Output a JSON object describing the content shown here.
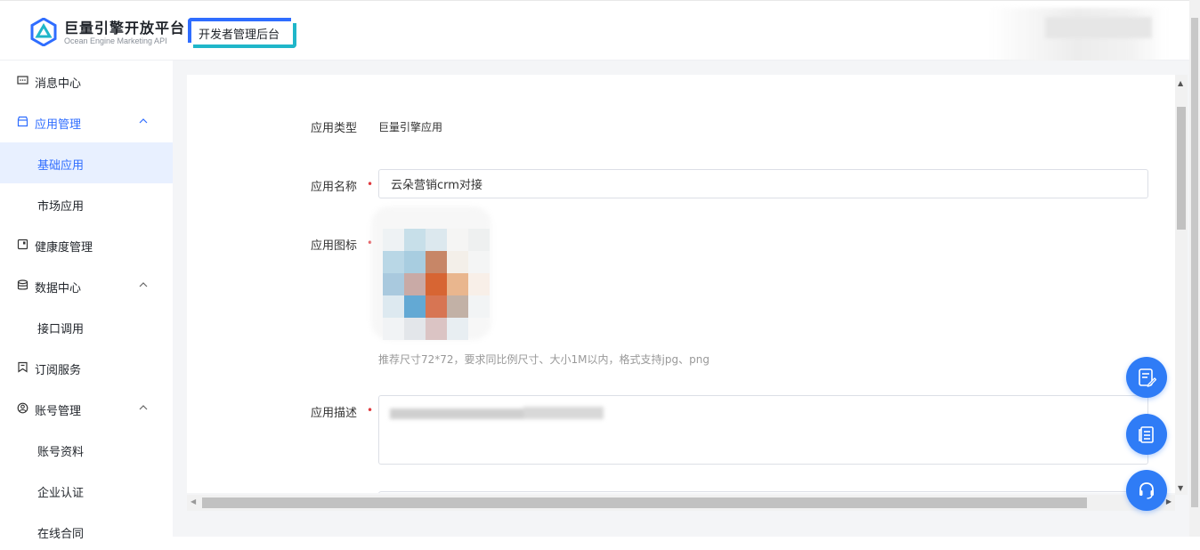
{
  "header": {
    "logo_title": "巨量引擎开放平台",
    "logo_subtitle": "Ocean Engine Marketing API",
    "badge": "开发者管理后台"
  },
  "sidebar": {
    "items": [
      {
        "label": "消息中心",
        "icon": "message-icon"
      },
      {
        "label": "应用管理",
        "icon": "app-store-icon",
        "expanded": true
      },
      {
        "label": "基础应用",
        "sub": true,
        "selected": true
      },
      {
        "label": "市场应用",
        "sub": true
      },
      {
        "label": "健康度管理",
        "icon": "health-icon"
      },
      {
        "label": "数据中心",
        "icon": "database-icon",
        "expanded": true
      },
      {
        "label": "接口调用",
        "sub": true
      },
      {
        "label": "订阅服务",
        "icon": "bookmark-icon"
      },
      {
        "label": "账号管理",
        "icon": "account-icon",
        "expanded": true
      },
      {
        "label": "账号资料",
        "sub": true
      },
      {
        "label": "企业认证",
        "sub": true
      },
      {
        "label": "在线合同",
        "sub": true
      }
    ]
  },
  "form": {
    "app_type_label": "应用类型",
    "app_type_value": "巨量引擎应用",
    "app_name_label": "应用名称",
    "app_name_value": "云朵营销crm对接",
    "app_icon_label": "应用图标",
    "app_icon_hint": "推荐尺寸72*72，要求同比例尺寸、大小1M以内，格式支持jpg、png",
    "app_desc_label": "应用描述",
    "required_mark": "•"
  },
  "colors": {
    "accent": "#2f6dff",
    "accent_cyan": "#1fb6c9",
    "required": "#e0393e",
    "fab": "#2f7cf6",
    "selected_bg": "#e8f0ff"
  },
  "floating_buttons": [
    "feedback-edit-icon",
    "document-icon",
    "customer-service-icon"
  ]
}
